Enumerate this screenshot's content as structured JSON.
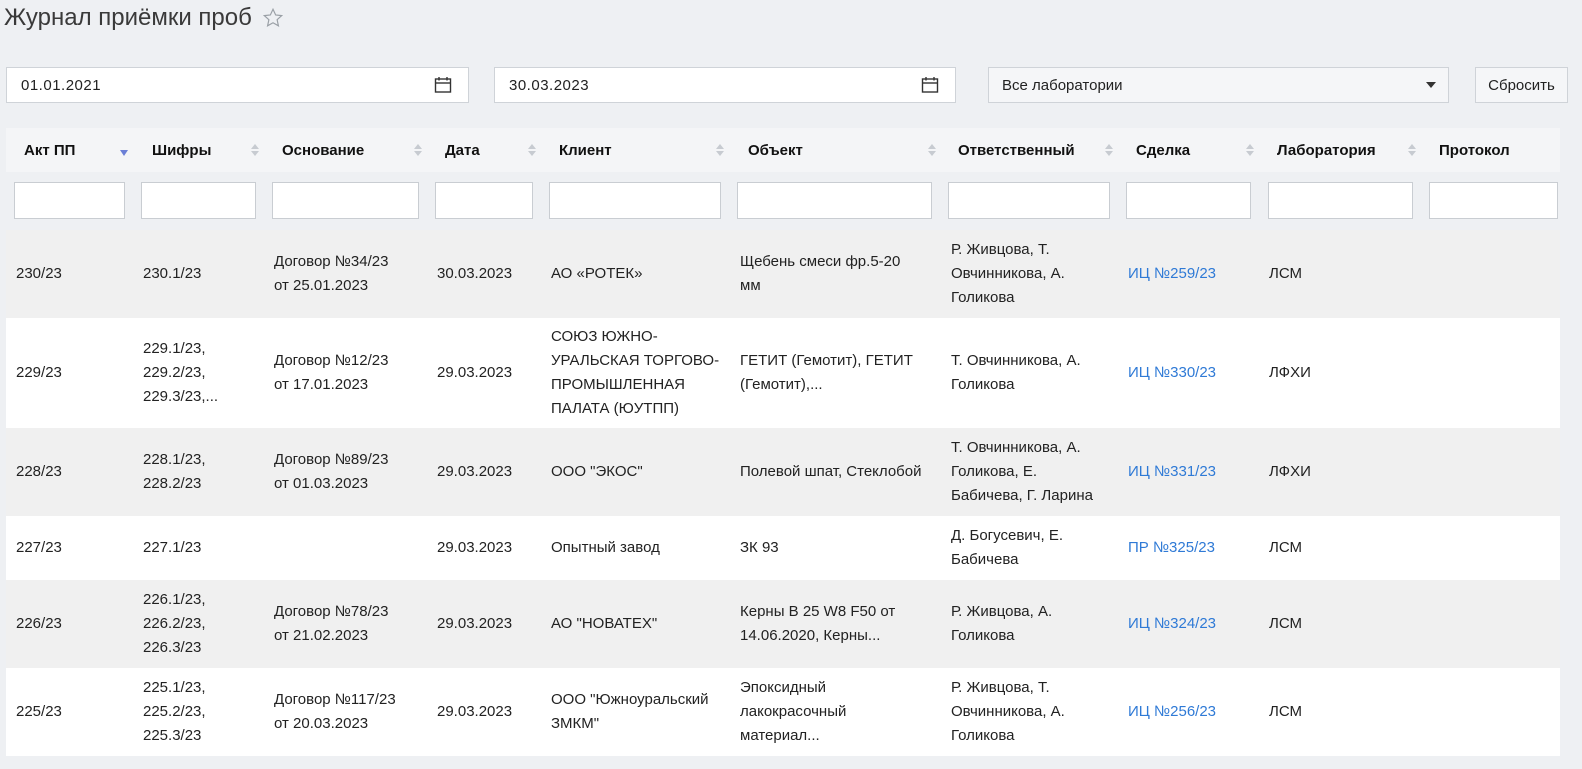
{
  "page": {
    "title": "Журнал приёмки проб"
  },
  "filters": {
    "date_from": "01.01.2021",
    "date_to": "30.03.2023",
    "laboratory": "Все лаборатории",
    "reset_label": "Сбросить"
  },
  "table": {
    "columns": [
      "Акт ПП",
      "Шифры",
      "Основание",
      "Дата",
      "Клиент",
      "Объект",
      "Ответственный",
      "Сделка",
      "Лаборатория",
      "Протокол"
    ],
    "rows": [
      {
        "akt": "230/23",
        "ciphers": "230.1/23",
        "basis": "Договор №34/23\nот 25.01.2023",
        "date": "30.03.2023",
        "client": "АО «РОТЕК»",
        "object": "Щебень смеси фр.5-20\nмм",
        "responsible": "Р. Живцова, Т.\nОвчинникова, А.\nГоликова",
        "deal": "ИЦ №259/23",
        "lab": "ЛСМ",
        "protocol": ""
      },
      {
        "akt": "229/23",
        "ciphers": "229.1/23,\n229.2/23,\n229.3/23,...",
        "basis": "Договор №12/23\nот 17.01.2023",
        "date": "29.03.2023",
        "client": "СОЮЗ ЮЖНО-\nУРАЛЬСКАЯ ТОРГОВО-\nПРОМЫШЛЕННАЯ\nПАЛАТА (ЮУТПП)",
        "object": "ГЕТИТ (Гемотит), ГЕТИТ\n(Гемотит),...",
        "responsible": "Т. Овчинникова, А.\nГоликова",
        "deal": "ИЦ №330/23",
        "lab": "ЛФХИ",
        "protocol": ""
      },
      {
        "akt": "228/23",
        "ciphers": "228.1/23,\n228.2/23",
        "basis": "Договор №89/23\nот 01.03.2023",
        "date": "29.03.2023",
        "client": "ООО \"ЭКОС\"",
        "object": "Полевой шпат, Стеклобой",
        "responsible": "Т. Овчинникова, А.\nГоликова, Е.\nБабичева, Г. Ларина",
        "deal": "ИЦ №331/23",
        "lab": "ЛФХИ",
        "protocol": ""
      },
      {
        "akt": "227/23",
        "ciphers": "227.1/23",
        "basis": "",
        "date": "29.03.2023",
        "client": "Опытный завод",
        "object": "ЗК 93",
        "responsible": "Д. Богусевич, Е.\nБабичева",
        "deal": "ПР №325/23",
        "lab": "ЛСМ",
        "protocol": ""
      },
      {
        "akt": "226/23",
        "ciphers": "226.1/23,\n226.2/23,\n226.3/23",
        "basis": "Договор №78/23\nот 21.02.2023",
        "date": "29.03.2023",
        "client": "АО \"НОВАТЕХ\"",
        "object": "Керны В 25 W8 F50 от\n14.06.2020, Керны...",
        "responsible": "Р. Живцова, А.\nГоликова",
        "deal": "ИЦ №324/23",
        "lab": "ЛСМ",
        "protocol": ""
      },
      {
        "akt": "225/23",
        "ciphers": "225.1/23,\n225.2/23,\n225.3/23",
        "basis": "Договор №117/23\nот 20.03.2023",
        "date": "29.03.2023",
        "client": "ООО \"Южноуральский\nЗМКМ\"",
        "object": "Эпоксидный\nлакокрасочный\nматериал...",
        "responsible": "Р. Живцова, Т.\nОвчинникова, А.\nГоликова",
        "deal": "ИЦ №256/23",
        "lab": "ЛСМ",
        "protocol": ""
      }
    ]
  },
  "colors": {
    "link": "#2f7ad6",
    "sort_active": "#6b7fd6"
  }
}
